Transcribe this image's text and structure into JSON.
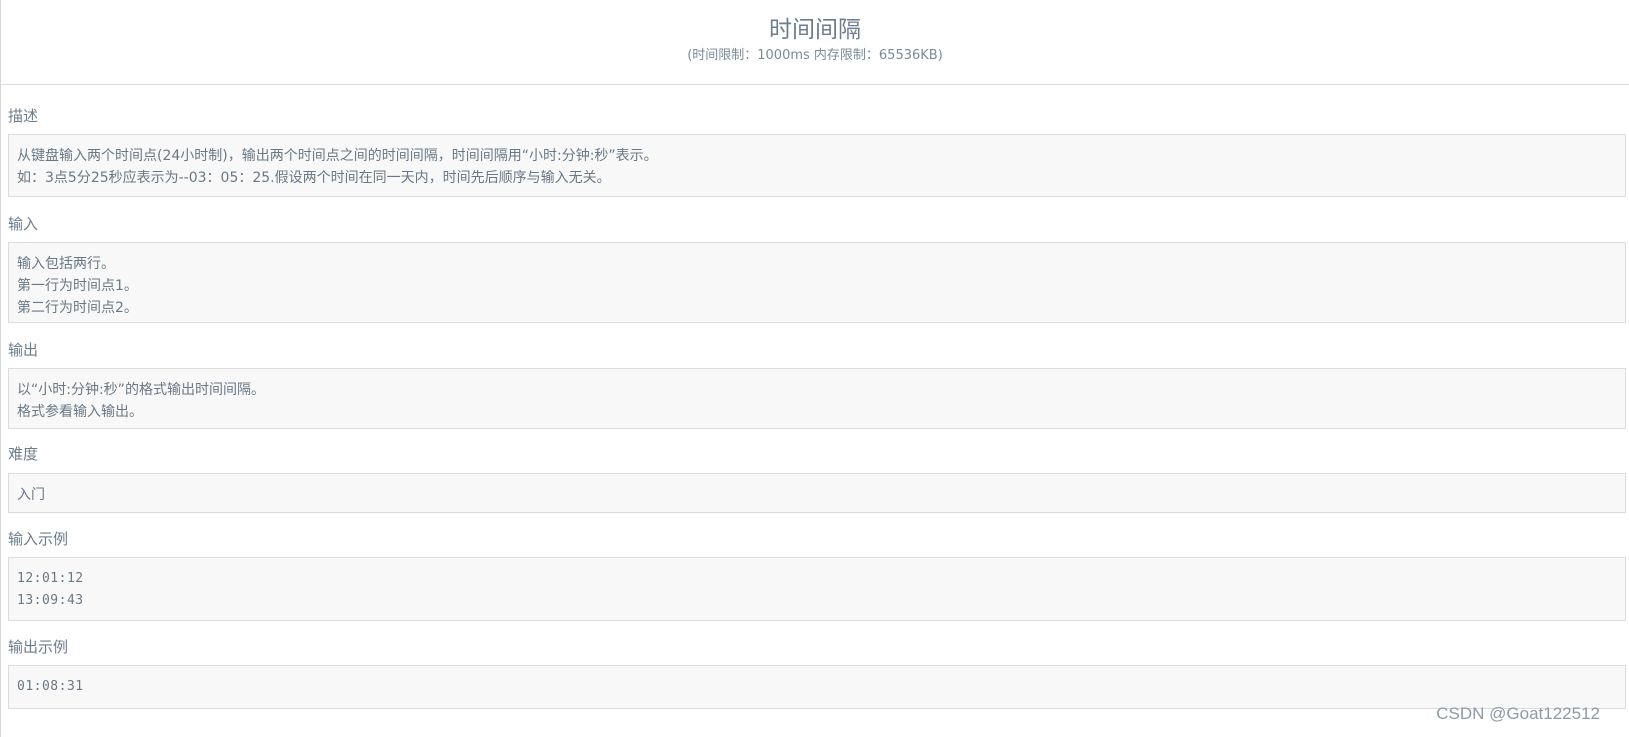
{
  "problem": {
    "title": "时间间隔",
    "limits": "(时间限制：1000ms 内存限制：65536KB)"
  },
  "sections": {
    "description": {
      "label": "描述",
      "lines": [
        "从键盘输入两个时间点(24小时制)，输出两个时间点之间的时间间隔，时间间隔用“小时:分钟:秒”表示。",
        "如：3点5分25秒应表示为--03：05：25.假设两个时间在同一天内，时间先后顺序与输入无关。"
      ]
    },
    "input": {
      "label": "输入",
      "lines": [
        "输入包括两行。",
        "第一行为时间点1。",
        "第二行为时间点2。"
      ]
    },
    "output": {
      "label": "输出",
      "lines": [
        "以“小时:分钟:秒”的格式输出时间间隔。",
        "格式参看输入输出。"
      ]
    },
    "difficulty": {
      "label": "难度",
      "value": "入门"
    },
    "sample_input": {
      "label": "输入示例",
      "lines": [
        "12:01:12",
        "13:09:43"
      ]
    },
    "sample_output": {
      "label": "输出示例",
      "lines": [
        "01:08:31"
      ]
    }
  },
  "watermark": "CSDN @Goat122512"
}
